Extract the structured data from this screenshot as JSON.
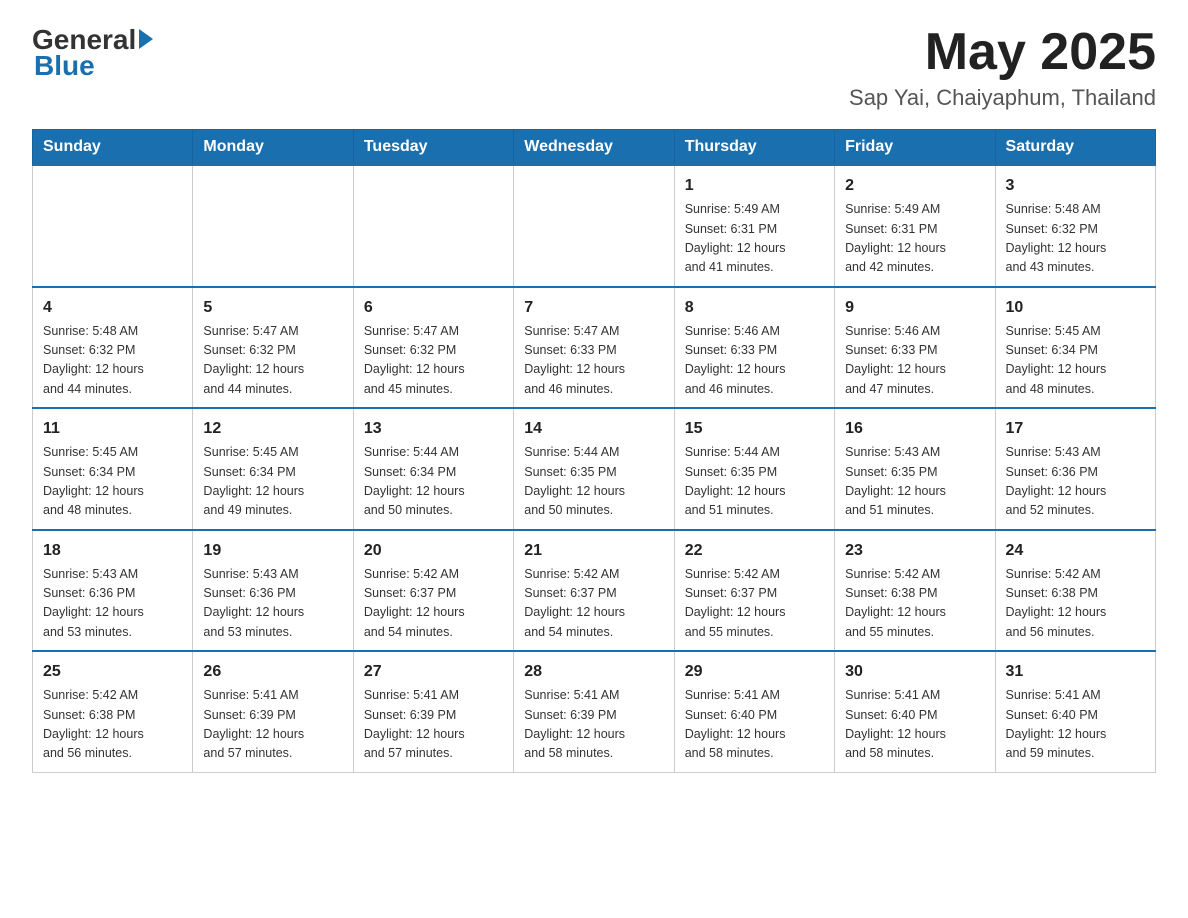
{
  "header": {
    "logo_general": "General",
    "logo_blue": "Blue",
    "month_year": "May 2025",
    "location": "Sap Yai, Chaiyaphum, Thailand"
  },
  "days_of_week": [
    "Sunday",
    "Monday",
    "Tuesday",
    "Wednesday",
    "Thursday",
    "Friday",
    "Saturday"
  ],
  "weeks": [
    [
      {
        "day": "",
        "info": ""
      },
      {
        "day": "",
        "info": ""
      },
      {
        "day": "",
        "info": ""
      },
      {
        "day": "",
        "info": ""
      },
      {
        "day": "1",
        "info": "Sunrise: 5:49 AM\nSunset: 6:31 PM\nDaylight: 12 hours\nand 41 minutes."
      },
      {
        "day": "2",
        "info": "Sunrise: 5:49 AM\nSunset: 6:31 PM\nDaylight: 12 hours\nand 42 minutes."
      },
      {
        "day": "3",
        "info": "Sunrise: 5:48 AM\nSunset: 6:32 PM\nDaylight: 12 hours\nand 43 minutes."
      }
    ],
    [
      {
        "day": "4",
        "info": "Sunrise: 5:48 AM\nSunset: 6:32 PM\nDaylight: 12 hours\nand 44 minutes."
      },
      {
        "day": "5",
        "info": "Sunrise: 5:47 AM\nSunset: 6:32 PM\nDaylight: 12 hours\nand 44 minutes."
      },
      {
        "day": "6",
        "info": "Sunrise: 5:47 AM\nSunset: 6:32 PM\nDaylight: 12 hours\nand 45 minutes."
      },
      {
        "day": "7",
        "info": "Sunrise: 5:47 AM\nSunset: 6:33 PM\nDaylight: 12 hours\nand 46 minutes."
      },
      {
        "day": "8",
        "info": "Sunrise: 5:46 AM\nSunset: 6:33 PM\nDaylight: 12 hours\nand 46 minutes."
      },
      {
        "day": "9",
        "info": "Sunrise: 5:46 AM\nSunset: 6:33 PM\nDaylight: 12 hours\nand 47 minutes."
      },
      {
        "day": "10",
        "info": "Sunrise: 5:45 AM\nSunset: 6:34 PM\nDaylight: 12 hours\nand 48 minutes."
      }
    ],
    [
      {
        "day": "11",
        "info": "Sunrise: 5:45 AM\nSunset: 6:34 PM\nDaylight: 12 hours\nand 48 minutes."
      },
      {
        "day": "12",
        "info": "Sunrise: 5:45 AM\nSunset: 6:34 PM\nDaylight: 12 hours\nand 49 minutes."
      },
      {
        "day": "13",
        "info": "Sunrise: 5:44 AM\nSunset: 6:34 PM\nDaylight: 12 hours\nand 50 minutes."
      },
      {
        "day": "14",
        "info": "Sunrise: 5:44 AM\nSunset: 6:35 PM\nDaylight: 12 hours\nand 50 minutes."
      },
      {
        "day": "15",
        "info": "Sunrise: 5:44 AM\nSunset: 6:35 PM\nDaylight: 12 hours\nand 51 minutes."
      },
      {
        "day": "16",
        "info": "Sunrise: 5:43 AM\nSunset: 6:35 PM\nDaylight: 12 hours\nand 51 minutes."
      },
      {
        "day": "17",
        "info": "Sunrise: 5:43 AM\nSunset: 6:36 PM\nDaylight: 12 hours\nand 52 minutes."
      }
    ],
    [
      {
        "day": "18",
        "info": "Sunrise: 5:43 AM\nSunset: 6:36 PM\nDaylight: 12 hours\nand 53 minutes."
      },
      {
        "day": "19",
        "info": "Sunrise: 5:43 AM\nSunset: 6:36 PM\nDaylight: 12 hours\nand 53 minutes."
      },
      {
        "day": "20",
        "info": "Sunrise: 5:42 AM\nSunset: 6:37 PM\nDaylight: 12 hours\nand 54 minutes."
      },
      {
        "day": "21",
        "info": "Sunrise: 5:42 AM\nSunset: 6:37 PM\nDaylight: 12 hours\nand 54 minutes."
      },
      {
        "day": "22",
        "info": "Sunrise: 5:42 AM\nSunset: 6:37 PM\nDaylight: 12 hours\nand 55 minutes."
      },
      {
        "day": "23",
        "info": "Sunrise: 5:42 AM\nSunset: 6:38 PM\nDaylight: 12 hours\nand 55 minutes."
      },
      {
        "day": "24",
        "info": "Sunrise: 5:42 AM\nSunset: 6:38 PM\nDaylight: 12 hours\nand 56 minutes."
      }
    ],
    [
      {
        "day": "25",
        "info": "Sunrise: 5:42 AM\nSunset: 6:38 PM\nDaylight: 12 hours\nand 56 minutes."
      },
      {
        "day": "26",
        "info": "Sunrise: 5:41 AM\nSunset: 6:39 PM\nDaylight: 12 hours\nand 57 minutes."
      },
      {
        "day": "27",
        "info": "Sunrise: 5:41 AM\nSunset: 6:39 PM\nDaylight: 12 hours\nand 57 minutes."
      },
      {
        "day": "28",
        "info": "Sunrise: 5:41 AM\nSunset: 6:39 PM\nDaylight: 12 hours\nand 58 minutes."
      },
      {
        "day": "29",
        "info": "Sunrise: 5:41 AM\nSunset: 6:40 PM\nDaylight: 12 hours\nand 58 minutes."
      },
      {
        "day": "30",
        "info": "Sunrise: 5:41 AM\nSunset: 6:40 PM\nDaylight: 12 hours\nand 58 minutes."
      },
      {
        "day": "31",
        "info": "Sunrise: 5:41 AM\nSunset: 6:40 PM\nDaylight: 12 hours\nand 59 minutes."
      }
    ]
  ]
}
